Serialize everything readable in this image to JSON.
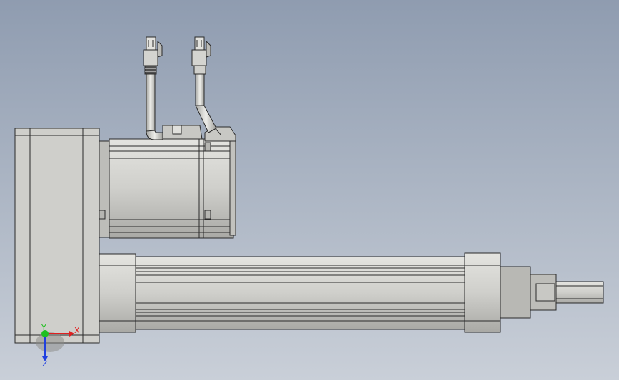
{
  "triad": {
    "x_label": "X",
    "y_label": "Y",
    "z_label": "Z",
    "x_color": "#e02020",
    "y_color": "#20c020",
    "z_color": "#2040e0"
  },
  "colors": {
    "metal_light": "#d8d8d4",
    "metal_mid": "#c6c6c2",
    "metal_dark": "#a8a8a4",
    "metal_shadow": "#8c8c88",
    "edge": "#2a2a2a"
  },
  "icons": {
    "connector_1": "connector-plug-icon",
    "connector_2": "connector-plug-icon"
  }
}
